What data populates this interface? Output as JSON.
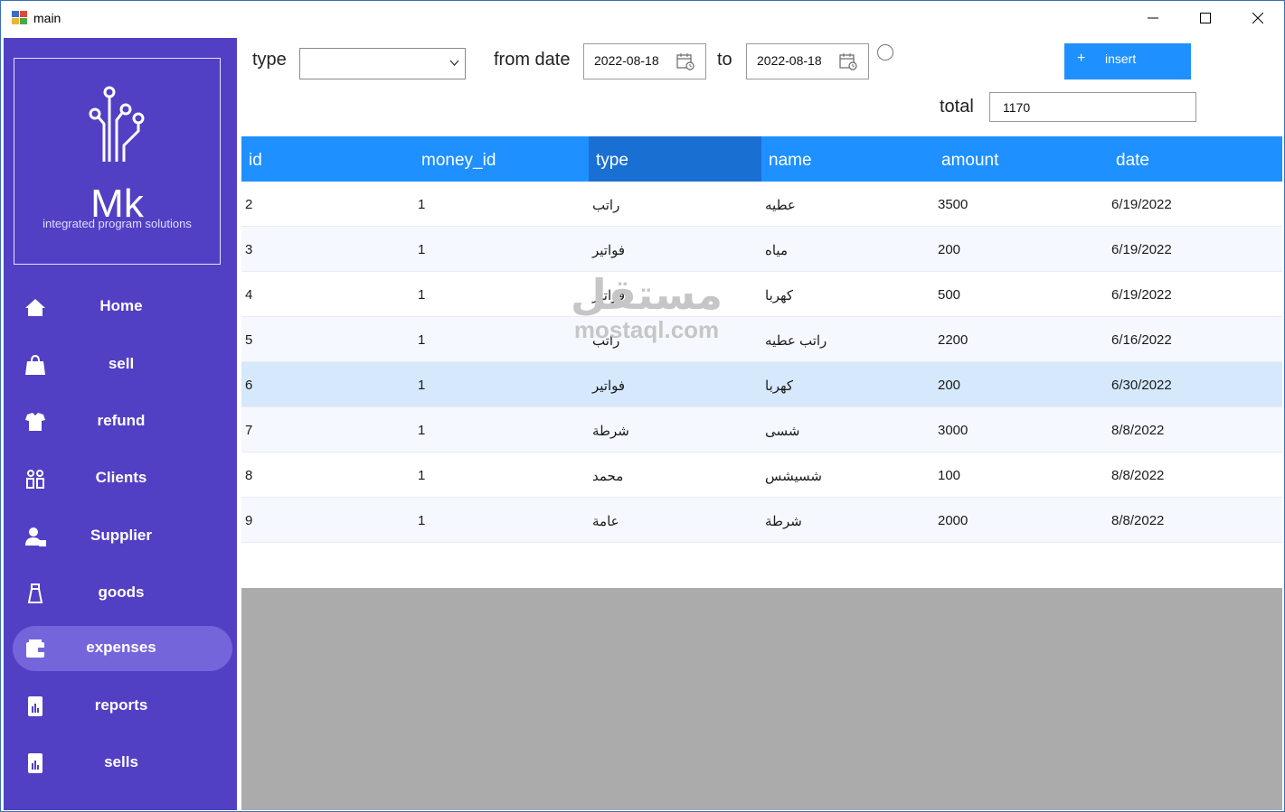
{
  "window": {
    "title": "main"
  },
  "brand": {
    "logo_text": "Mk",
    "tagline": "integrated program solutions"
  },
  "sidebar": {
    "items": [
      {
        "label": "Home",
        "icon": "home-icon",
        "active": false
      },
      {
        "label": "sell",
        "icon": "shopping-bag-icon",
        "active": false
      },
      {
        "label": "refund",
        "icon": "refund-icon",
        "active": false
      },
      {
        "label": "Clients",
        "icon": "clients-icon",
        "active": false
      },
      {
        "label": "Supplier",
        "icon": "supplier-icon",
        "active": false
      },
      {
        "label": "goods",
        "icon": "goods-icon",
        "active": false
      },
      {
        "label": "expenses",
        "icon": "wallet-icon",
        "active": true
      },
      {
        "label": "reports",
        "icon": "report-icon",
        "active": false
      },
      {
        "label": "sells",
        "icon": "report-icon",
        "active": false
      }
    ]
  },
  "filters": {
    "type_label": "type",
    "type_value": "",
    "from_label": "from date",
    "from_value": "2022-08-18",
    "to_label": "to",
    "to_value": "2022-08-18",
    "insert_label": "insert",
    "total_label": "total",
    "total_value": "1170"
  },
  "table": {
    "columns": [
      "id",
      "money_id",
      "type",
      "name",
      "amount",
      "date"
    ],
    "selected_column": 2,
    "selected_row": 4,
    "rows": [
      [
        "2",
        "1",
        "راتب",
        "عطيه",
        "3500",
        "6/19/2022"
      ],
      [
        "3",
        "1",
        "فواتير",
        "مياه",
        "200",
        "6/19/2022"
      ],
      [
        "4",
        "1",
        "فواتير",
        "كهربا",
        "500",
        "6/19/2022"
      ],
      [
        "5",
        "1",
        "راتب",
        "راتب عطيه",
        "2200",
        "6/16/2022"
      ],
      [
        "6",
        "1",
        "فواتير",
        "كهربا",
        "200",
        "6/30/2022"
      ],
      [
        "7",
        "1",
        "شرطة",
        "شسى",
        "3000",
        "8/8/2022"
      ],
      [
        "8",
        "1",
        "محمد",
        "شسيشس",
        "100",
        "8/8/2022"
      ],
      [
        "9",
        "1",
        "عامة",
        "شرطة",
        "2000",
        "8/8/2022"
      ]
    ]
  },
  "watermark": {
    "arabic": "مستقل",
    "latin": "mostaql.com"
  },
  "colors": {
    "sidebar": "#5140c4",
    "active_item": "#7565db",
    "header": "#1e90ff",
    "header_selected": "#1970d2",
    "selected_row": "#d6e8fc"
  }
}
